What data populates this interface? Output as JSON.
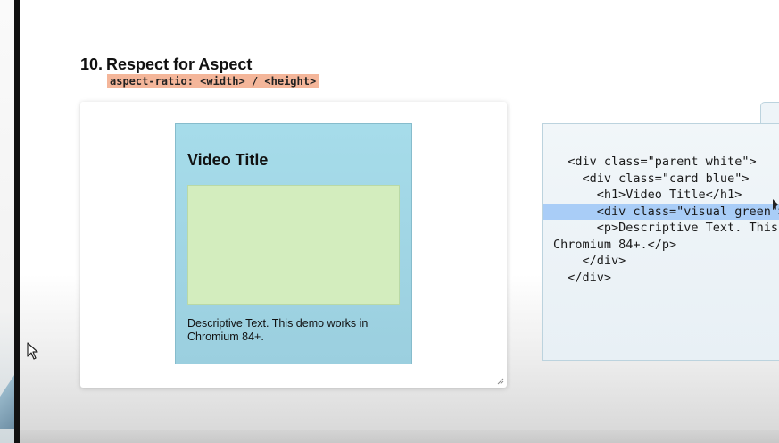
{
  "slide": {
    "number": "10.",
    "title": "Respect for Aspect",
    "syntax": "aspect-ratio: <width> / <height>"
  },
  "demo": {
    "card_title": "Video Title",
    "description": "Descriptive Text. This demo works in Chromium 84+."
  },
  "code": {
    "lines": [
      "  <div class=\"parent white\">",
      "    <div class=\"card blue\">",
      "      <h1>Video Title</h1>",
      "      <div class=\"visual green\">",
      "      <p>Descriptive Text. This demo works in",
      "Chromium 84+.</p>",
      "    </div>",
      "  </div>"
    ],
    "highlighted_line": 3
  },
  "colors": {
    "syntax_highlight": "#f4b69a",
    "card_blue": "#a6dcea",
    "visual_green": "#d3edbe",
    "code_selection": "#a9cdf7"
  }
}
